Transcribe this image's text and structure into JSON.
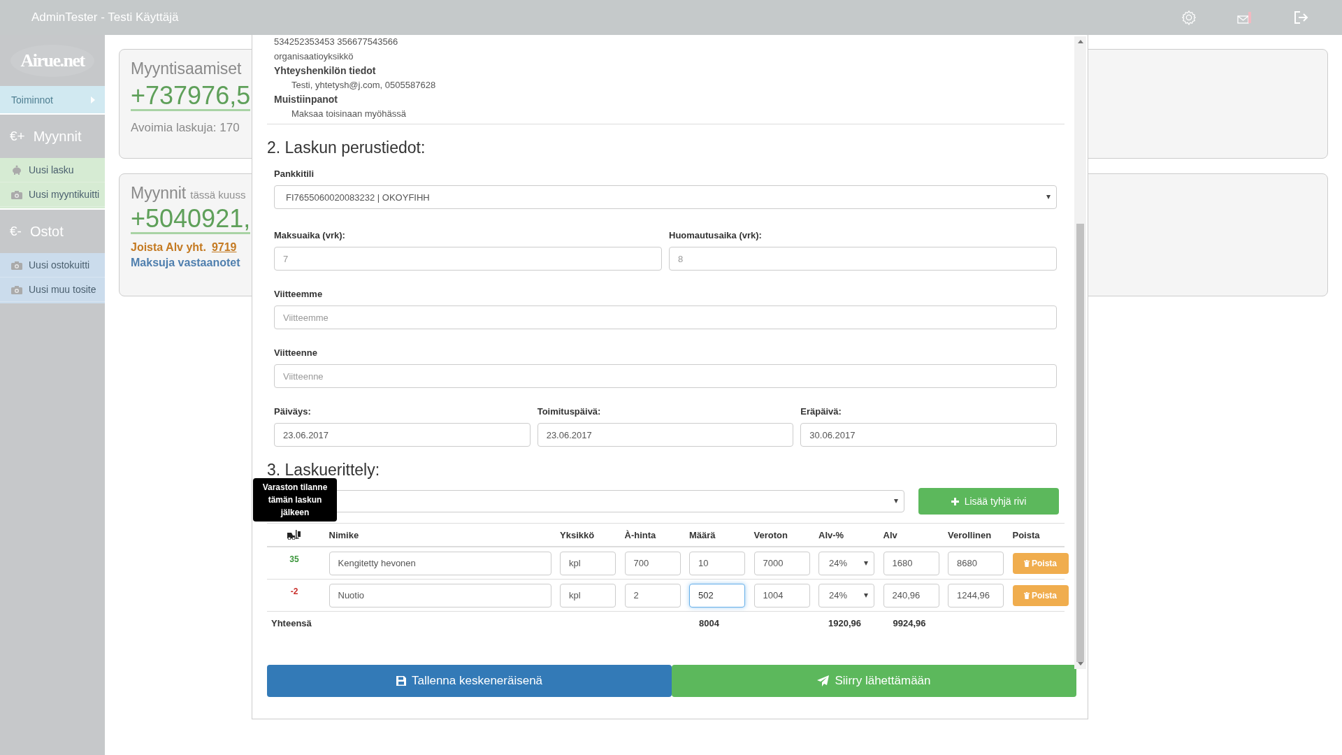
{
  "header": {
    "title": "AdminTester - Testi Käyttäjä"
  },
  "sidebar": {
    "logo": "Airue.net",
    "menu_toggle": "Toiminnot",
    "groups": [
      {
        "symbol": "€+",
        "title": "Myynnit",
        "color": "#d6ebd3",
        "items": [
          {
            "label": "Uusi lasku",
            "kind": "invoice"
          },
          {
            "label": "Uusi myyntikuitti",
            "kind": "receipt"
          }
        ]
      },
      {
        "symbol": "€-",
        "title": "Ostot",
        "color": "#cbdcec",
        "items": [
          {
            "label": "Uusi ostokuitti",
            "kind": "receipt"
          },
          {
            "label": "Uusi muu tosite",
            "kind": "receipt"
          }
        ]
      }
    ]
  },
  "cards": [
    {
      "title": "Myyntisaamiset",
      "amount": "+737976,5",
      "note": "Avoimia laskuja: 170"
    },
    {
      "title": "Myynnit",
      "subtitle": "tässä kuuss",
      "amount": "+5040921,",
      "vat_label": "Joista Alv yht.",
      "vat_amount": "9719",
      "payments": "Maksuja vastaanotet"
    }
  ],
  "invoice": {
    "customer_info": [
      {
        "kind": "text",
        "text": "534252353453 356677543566"
      },
      {
        "kind": "text",
        "text": "organisaatioyksikkö"
      },
      {
        "kind": "heading",
        "text": "Yhteyshenkilön tiedot"
      },
      {
        "kind": "detail",
        "text": "Testi, yhtetysh@j.com, 0505587628"
      },
      {
        "kind": "heading",
        "text": "Muistiinpanot"
      },
      {
        "kind": "detail",
        "text": "Maksaa toisinaan myöhässä"
      }
    ],
    "basic_title": "2. Laskun perustiedot:",
    "bank_account": {
      "label": "Pankkitili",
      "value": "FI7655060020083232 | OKOYFIHH"
    },
    "payment_terms": [
      {
        "label": "Maksuaika (vrk):",
        "placeholder": "7"
      },
      {
        "label": "Huomautusaika (vrk):",
        "placeholder": "8"
      }
    ],
    "references": [
      {
        "label": "Viitteemme",
        "placeholder": "Viitteemme"
      },
      {
        "label": "Viitteenne",
        "placeholder": "Viitteenne"
      }
    ],
    "dates": [
      {
        "label": "Päiväys:",
        "value": "23.06.2017"
      },
      {
        "label": "Toimituspäivä:",
        "value": "23.06.2017"
      },
      {
        "label": "Eräpäivä:",
        "value": "30.06.2017"
      }
    ],
    "items_title": "3. Laskuerittely:",
    "add_row_button": "Lisää tyhjä rivi",
    "tooltip": "Varaston tilanne tämän laskun jälkeen",
    "columns": [
      "Nimike",
      "Yksikkö",
      "À-hinta",
      "Määrä",
      "Veroton",
      "Alv-%",
      "Alv",
      "Verollinen",
      "Poista"
    ],
    "rows": [
      {
        "stock": "35",
        "color": "#3c963c",
        "name": "Kengitetty hevonen",
        "unit": "kpl",
        "unit_price": "700",
        "quantity": "10",
        "quantity_focused": false,
        "net": "7000",
        "vat_rate": "24%",
        "vat": "1680",
        "gross": "8680",
        "delete": "Poista"
      },
      {
        "stock": "-2",
        "color": "#c9302c",
        "name": "Nuotio",
        "unit": "kpl",
        "unit_price": "2",
        "quantity": "502",
        "quantity_focused": true,
        "net": "1004",
        "vat_rate": "24%",
        "vat": "240,96",
        "gross": "1244,96",
        "delete": "Poista"
      }
    ],
    "totals": {
      "label": "Yhteensä",
      "net": "8004",
      "vat": "1920,96",
      "gross": "9924,96"
    },
    "buttons": [
      {
        "kind": "save",
        "label": "Tallenna keskeneräisenä"
      },
      {
        "kind": "send",
        "label": "Siirry lähettämään"
      }
    ]
  }
}
